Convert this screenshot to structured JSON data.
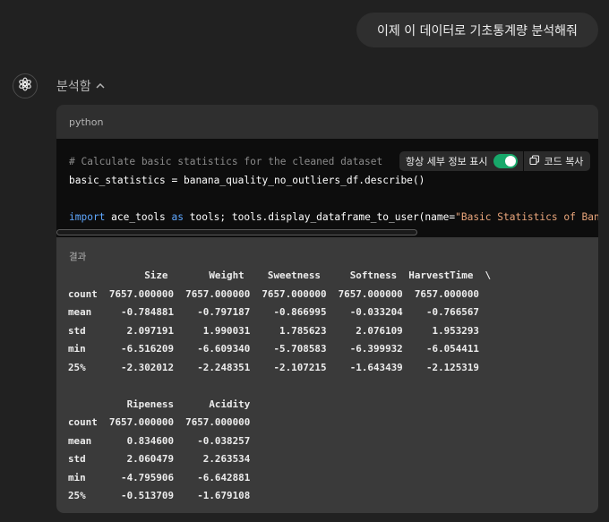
{
  "user_message": "이제 이 데이터로 기초통계량 분석해줘",
  "assistant": {
    "avatar_icon": "openai-logo-icon",
    "status_label": "분석함",
    "status_chevron": "^"
  },
  "code_block": {
    "language": "python",
    "toggle_label": "항상 세부 정보 표시",
    "toggle_on": true,
    "copy_label": "코드 복사",
    "line1": "# Calculate basic statistics for the cleaned dataset",
    "line2": "basic_statistics = banana_quality_no_outliers_df.describe()",
    "line4_kw1": "import",
    "line4_mod": " ace_tools ",
    "line4_kw2": "as",
    "line4_rest": " tools; tools.display_dataframe_to_user(name=",
    "line4_str": "\"Basic Statistics of Banan"
  },
  "result": {
    "label": "결과",
    "table1": {
      "header": "             Size       Weight    Sweetness     Softness  HarvestTime  \\",
      "rows": [
        "count  7657.000000  7657.000000  7657.000000  7657.000000  7657.000000",
        "mean     -0.784881    -0.797187    -0.866995    -0.033204    -0.766567",
        "std       2.097191     1.990031     1.785623     2.076109     1.953293",
        "min      -6.516209    -6.609340    -5.708583    -6.399932    -6.054411",
        "25%      -2.302012    -2.248351    -2.107215    -1.643439    -2.125319"
      ]
    },
    "table2": {
      "header": "          Ripeness      Acidity",
      "rows": [
        "count  7657.000000  7657.000000",
        "mean      0.834600    -0.038257",
        "std       2.060479     2.263534",
        "min      -4.795906    -6.642881",
        "25%      -0.513709    -1.679108"
      ]
    }
  }
}
